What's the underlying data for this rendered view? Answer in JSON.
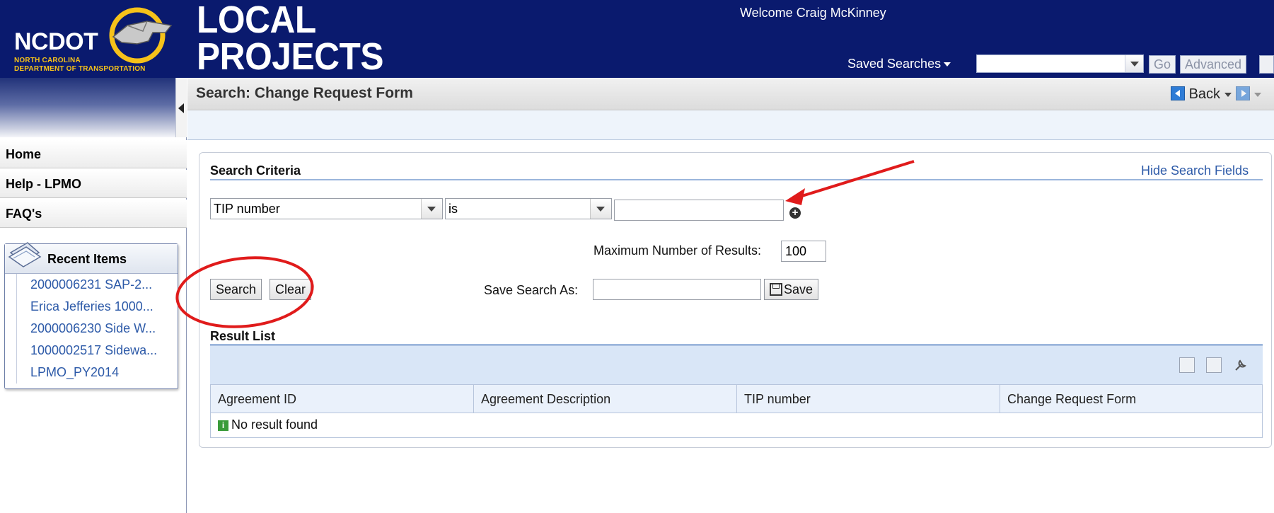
{
  "header": {
    "logo_name": "NCDOT",
    "logo_subtitle_line1": "NORTH CAROLINA",
    "logo_subtitle_line2": "DEPARTMENT OF TRANSPORTATION",
    "app_title_line1": "LOCAL",
    "app_title_line2": "PROJECTS",
    "welcome": "Welcome Craig McKinney",
    "saved_searches_label": "Saved Searches",
    "go_label": "Go",
    "advanced_label": "Advanced"
  },
  "sidebar": {
    "nav": [
      {
        "label": "Home"
      },
      {
        "label": "Help - LPMO"
      },
      {
        "label": "FAQ's"
      }
    ],
    "recent": {
      "title": "Recent Items",
      "items": [
        {
          "label": "2000006231 SAP-2..."
        },
        {
          "label": "Erica Jefferies 1000..."
        },
        {
          "label": "2000006230 Side W..."
        },
        {
          "label": "1000002517 Sidewa..."
        },
        {
          "label": "LPMO_PY2014"
        }
      ]
    }
  },
  "page": {
    "title": "Search: Change Request Form",
    "back_label": "Back"
  },
  "search": {
    "section_title": "Search Criteria",
    "hide_link": "Hide Search Fields",
    "field_value": "TIP number",
    "operator_value": "is",
    "value_input": "",
    "max_results_label": "Maximum Number of Results:",
    "max_results_value": "100",
    "search_button": "Search",
    "clear_button": "Clear",
    "save_as_label": "Save Search As:",
    "save_as_value": "",
    "save_button": "Save"
  },
  "results": {
    "section_title": "Result List",
    "columns": [
      "Agreement ID",
      "Agreement Description",
      "TIP number",
      "Change Request Form"
    ],
    "empty_message": "No result found"
  },
  "colors": {
    "header_bg": "#0a1a6e",
    "link": "#2d5aa8",
    "annotation": "#e01b1b"
  }
}
